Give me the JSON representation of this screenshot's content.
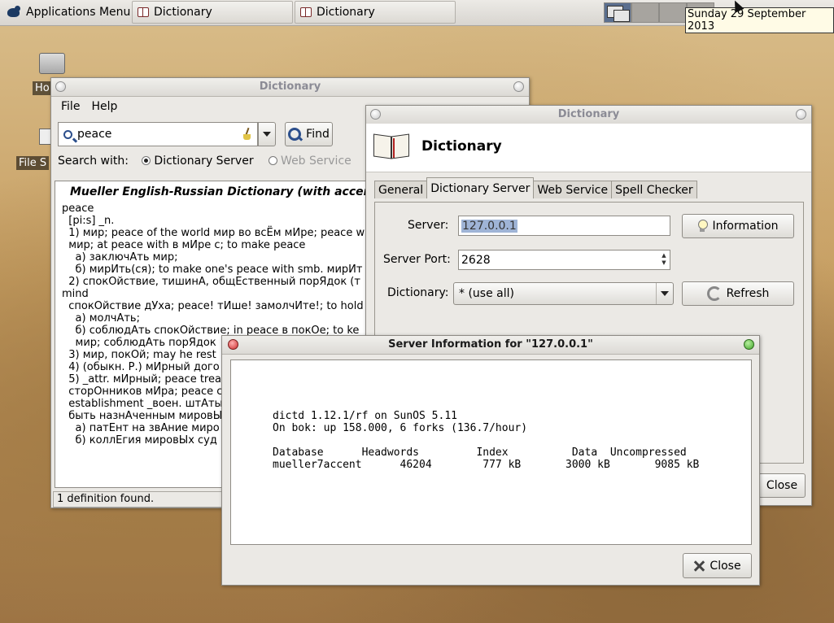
{
  "panel": {
    "app_menu": "Applications Menu",
    "tasks": [
      "Dictionary",
      "Dictionary"
    ],
    "clock": "Sunday 29 September 2013"
  },
  "desktop": {
    "icons": [
      "Ho",
      "File S"
    ]
  },
  "main_window": {
    "title": "Dictionary",
    "menu": [
      "File",
      "Help"
    ],
    "search_value": "peace",
    "find_label": "Find",
    "search_with_label": "Search with:",
    "search_options": [
      "Dictionary Server",
      "Web Service"
    ],
    "result_header": "Mueller English-Russian Dictionary (with accents)",
    "result_lines": [
      "peace",
      "  [pi:s] _n.",
      "  1) мир; peace of the world мир во всЁм мИре; peace w",
      "  мир; at peace with в мИре с; to make peace",
      "    а) заключАть мир;",
      "    б) мирИть(ся); to make one's peace with smb. мирИт",
      "  2) спокОйствие, тишинА, общЕственный порЯдок (т",
      "mind",
      "  спокОйствие дУха; peace! тИше! замолчИте!; to hold",
      "    а) молчАть;",
      "    б) соблюдАть спокОйствие; in peace в покОе; to ke",
      "    мир; соблюдАть порЯдок",
      "  3) мир, покОй; may he rest",
      "  4) (обыкн. Р.) мИрный дого",
      "  5) _attr. мИрный; peace trea",
      "  сторОнников мИра; peace с",
      "  establishment _воен. штАты",
      "  быть назнАченным мировЫ",
      "    а) патЕнт на звАние миро",
      "    б) коллЕгия мировЫх суд"
    ],
    "status": "1 definition found."
  },
  "prefs_window": {
    "title": "Dictionary",
    "header": "Dictionary",
    "tabs": [
      "General",
      "Dictionary Server",
      "Web Service",
      "Spell Checker"
    ],
    "server_label": "Server:",
    "server_value": "127.0.0.1",
    "port_label": "Server Port:",
    "port_value": "2628",
    "dictionary_label": "Dictionary:",
    "dictionary_value": "* (use all)",
    "information_button": "Information",
    "refresh_button": "Refresh",
    "close_button": "Close"
  },
  "info_dialog": {
    "title": "Server Information for \"127.0.0.1\"",
    "lines": [
      "dictd 1.12.1/rf on SunOS 5.11",
      "On bok: up 158.000, 6 forks (136.7/hour)",
      "",
      "Database      Headwords         Index          Data  Uncompressed",
      "mueller7accent      46204        777 kB       3000 kB       9085 kB"
    ],
    "close_button": "Close"
  }
}
